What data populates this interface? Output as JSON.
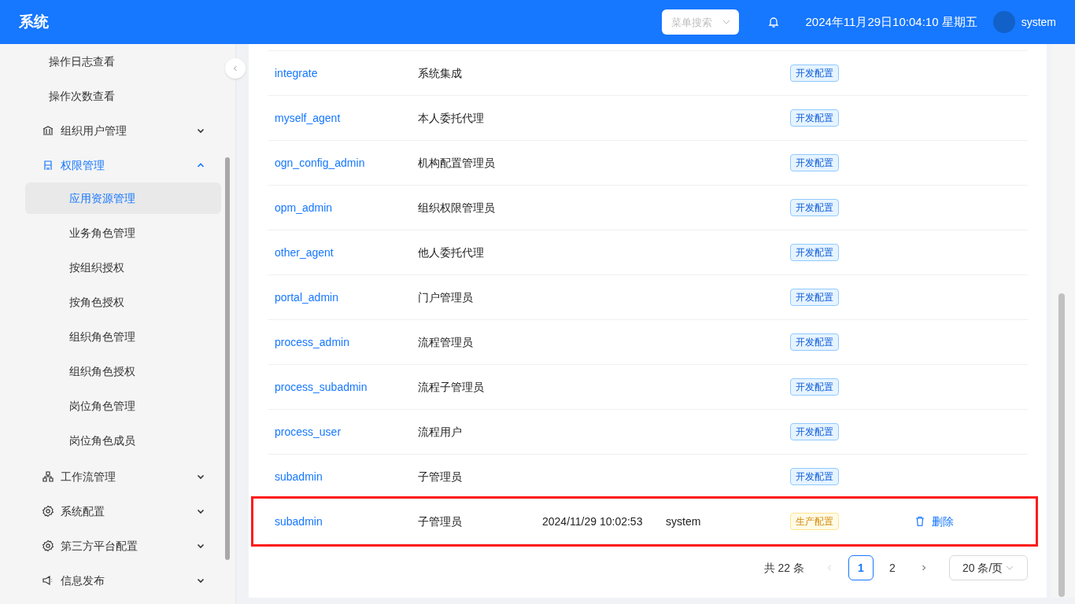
{
  "header": {
    "title": "系统",
    "menu_search": {
      "placeholder": "菜单搜索"
    },
    "datetime": "2024年11月29日10:04:10 星期五",
    "user": "system"
  },
  "sidebar": {
    "items": [
      {
        "label": "操作日志查看"
      },
      {
        "label": "操作次数查看"
      },
      {
        "label": "组织用户管理",
        "expanded": false
      },
      {
        "label": "权限管理",
        "expanded": true,
        "children": [
          {
            "label": "应用资源管理",
            "selected": true
          },
          {
            "label": "业务角色管理",
            "selected": false
          },
          {
            "label": "按组织授权",
            "selected": false
          },
          {
            "label": "按角色授权",
            "selected": false
          },
          {
            "label": "组织角色管理",
            "selected": false
          },
          {
            "label": "组织角色授权",
            "selected": false
          },
          {
            "label": "岗位角色管理",
            "selected": false
          },
          {
            "label": "岗位角色成员",
            "selected": false
          }
        ]
      },
      {
        "label": "工作流管理",
        "expanded": false
      },
      {
        "label": "系统配置",
        "expanded": false
      },
      {
        "label": "第三方平台配置",
        "expanded": false
      },
      {
        "label": "信息发布",
        "expanded": false
      }
    ]
  },
  "table": {
    "rows": [
      {
        "code": "integrate",
        "name": "系统集成",
        "tag": {
          "label": "开发配置",
          "kind": "dev"
        },
        "highlighted": false
      },
      {
        "code": "myself_agent",
        "name": "本人委托代理",
        "tag": {
          "label": "开发配置",
          "kind": "dev"
        },
        "highlighted": false
      },
      {
        "code": "ogn_config_admin",
        "name": "机构配置管理员",
        "tag": {
          "label": "开发配置",
          "kind": "dev"
        },
        "highlighted": false
      },
      {
        "code": "opm_admin",
        "name": "组织权限管理员",
        "tag": {
          "label": "开发配置",
          "kind": "dev"
        },
        "highlighted": false
      },
      {
        "code": "other_agent",
        "name": "他人委托代理",
        "tag": {
          "label": "开发配置",
          "kind": "dev"
        },
        "highlighted": false
      },
      {
        "code": "portal_admin",
        "name": "门户管理员",
        "tag": {
          "label": "开发配置",
          "kind": "dev"
        },
        "highlighted": false
      },
      {
        "code": "process_admin",
        "name": "流程管理员",
        "tag": {
          "label": "开发配置",
          "kind": "dev"
        },
        "highlighted": false
      },
      {
        "code": "process_subadmin",
        "name": "流程子管理员",
        "tag": {
          "label": "开发配置",
          "kind": "dev"
        },
        "highlighted": false
      },
      {
        "code": "process_user",
        "name": "流程用户",
        "tag": {
          "label": "开发配置",
          "kind": "dev"
        },
        "highlighted": false
      },
      {
        "code": "subadmin",
        "name": "子管理员",
        "tag": {
          "label": "开发配置",
          "kind": "dev"
        },
        "highlighted": false
      },
      {
        "code": "subadmin",
        "name": "子管理员",
        "time": "2024/11/29 10:02:53",
        "creator": "system",
        "tag": {
          "label": "生产配置",
          "kind": "prod"
        },
        "action": "删除",
        "highlighted": true
      }
    ]
  },
  "pagination": {
    "total": "共 22 条",
    "pages": [
      {
        "label": "1",
        "selected": true
      },
      {
        "label": "2",
        "selected": false
      }
    ],
    "page_size": "20 条/页"
  }
}
